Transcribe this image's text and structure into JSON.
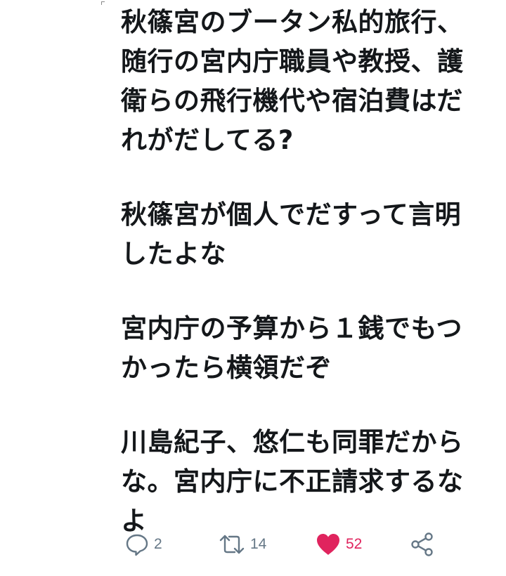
{
  "tweet": {
    "paragraphs": [
      "秋篠宮のブータン私的旅行、\n随行の宮内庁職員や教授、護\n衛らの飛行機代や宿泊費はだ\nれがだしてる?",
      "秋篠宮が個人でだすって言明\nしたよな",
      "宮内庁の予算から１銭でもつ\nかったら横領だぞ",
      "川島紀子、悠仁も同罪だから\nな。宮内庁に不正請求するな\nよ"
    ]
  },
  "actions": {
    "reply": {
      "icon": "reply-icon",
      "count": "2"
    },
    "retweet": {
      "icon": "retweet-icon",
      "count": "14"
    },
    "like": {
      "icon": "heart-icon",
      "count": "52",
      "active": true
    },
    "share": {
      "icon": "share-icon"
    }
  },
  "colors": {
    "text": "#14171a",
    "muted": "#657786",
    "like": "#e0245e"
  }
}
